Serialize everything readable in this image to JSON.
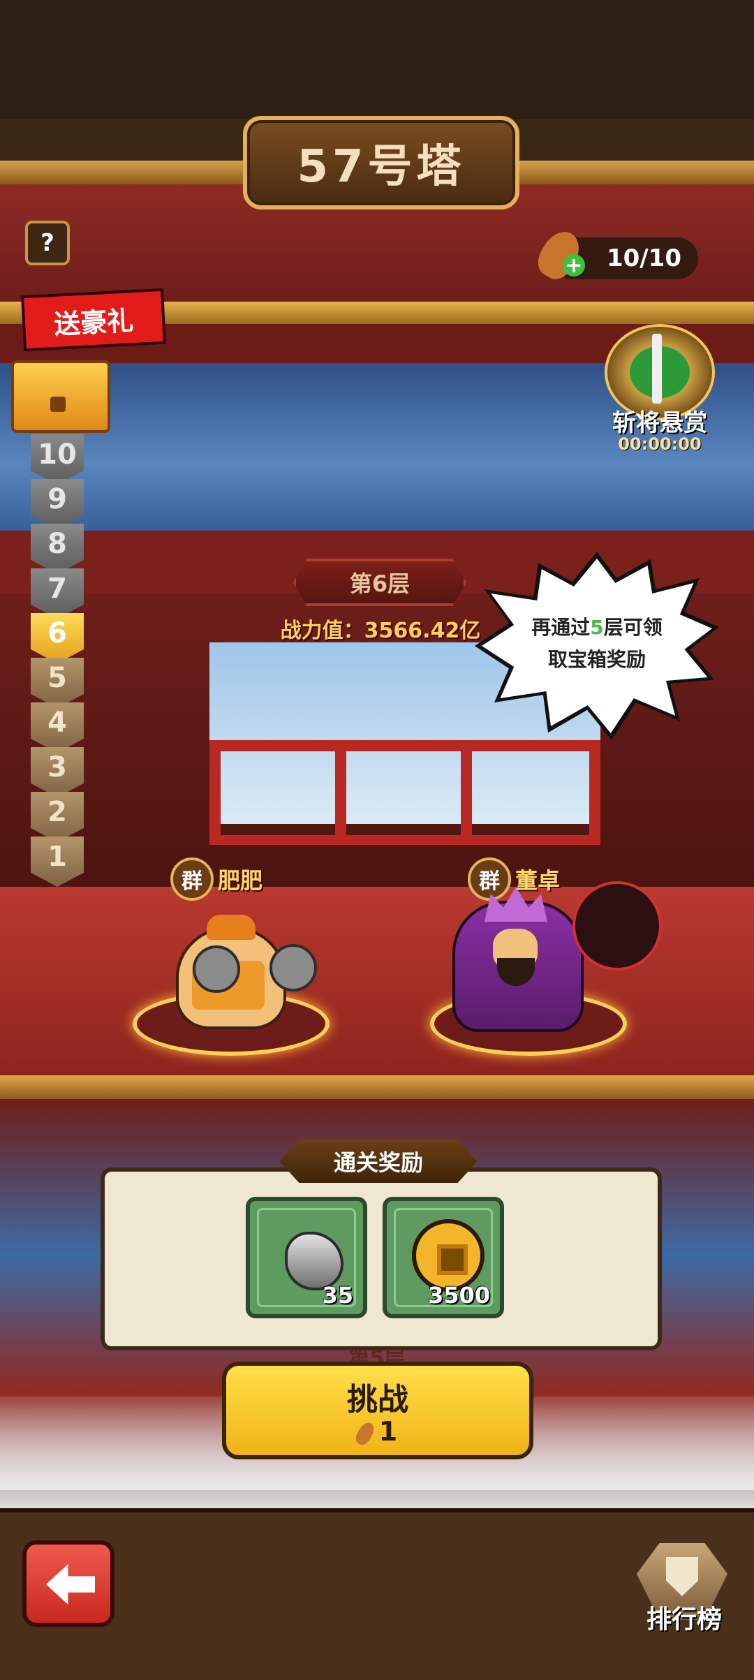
{
  "header": {
    "title": "57号塔"
  },
  "help": {
    "label": "?"
  },
  "stamina": {
    "value": "10/10"
  },
  "gift": {
    "label": "送豪礼"
  },
  "tower_floors": [
    {
      "label": "10",
      "state": "locked"
    },
    {
      "label": "9",
      "state": "locked"
    },
    {
      "label": "8",
      "state": "locked"
    },
    {
      "label": "7",
      "state": "locked"
    },
    {
      "label": "6",
      "state": "current"
    },
    {
      "label": "5",
      "state": "done"
    },
    {
      "label": "4",
      "state": "done"
    },
    {
      "label": "3",
      "state": "done"
    },
    {
      "label": "2",
      "state": "done"
    },
    {
      "label": "1",
      "state": "done"
    }
  ],
  "bounty": {
    "label": "斩将悬赏",
    "timer": "00:00:00"
  },
  "stage": {
    "floor_label": "第6层",
    "power_text": "战力值：3566.42亿",
    "tip_line1_pre": "再通过",
    "tip_line1_num": "5",
    "tip_line1_post": "层可领",
    "tip_line2": "取宝箱奖励"
  },
  "player": {
    "faction": "群",
    "name": "肥肥"
  },
  "enemy": {
    "faction": "群",
    "name": "董卓"
  },
  "rewards": {
    "title": "通关奖励",
    "items": [
      {
        "icon": "stone-icon",
        "count": "35"
      },
      {
        "icon": "coin-icon",
        "count": "3500"
      }
    ]
  },
  "next_floor_label": "第5层",
  "challenge": {
    "label": "挑战",
    "cost": "1"
  },
  "nav": {
    "back_icon": "back-arrow-icon",
    "rank_label": "排行榜"
  }
}
